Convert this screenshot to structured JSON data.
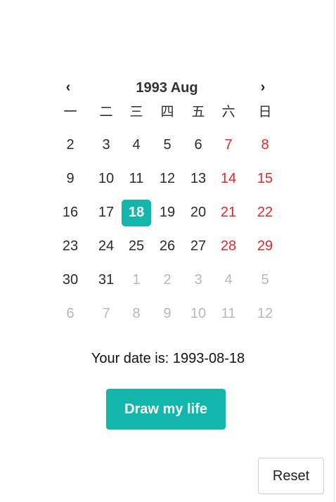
{
  "calendar": {
    "title": "1993 Aug",
    "prev_label": "‹",
    "next_label": "›",
    "weekdays": [
      "一",
      "二",
      "三",
      "四",
      "五",
      "六",
      "日"
    ],
    "weeks": [
      [
        {
          "d": "2"
        },
        {
          "d": "3"
        },
        {
          "d": "4"
        },
        {
          "d": "5"
        },
        {
          "d": "6"
        },
        {
          "d": "7",
          "weekend": true
        },
        {
          "d": "8",
          "weekend": true
        }
      ],
      [
        {
          "d": "9"
        },
        {
          "d": "10"
        },
        {
          "d": "11"
        },
        {
          "d": "12"
        },
        {
          "d": "13"
        },
        {
          "d": "14",
          "weekend": true
        },
        {
          "d": "15",
          "weekend": true
        }
      ],
      [
        {
          "d": "16"
        },
        {
          "d": "17"
        },
        {
          "d": "18",
          "selected": true
        },
        {
          "d": "19"
        },
        {
          "d": "20"
        },
        {
          "d": "21",
          "weekend": true
        },
        {
          "d": "22",
          "weekend": true
        }
      ],
      [
        {
          "d": "23"
        },
        {
          "d": "24"
        },
        {
          "d": "25"
        },
        {
          "d": "26"
        },
        {
          "d": "27"
        },
        {
          "d": "28",
          "weekend": true
        },
        {
          "d": "29",
          "weekend": true
        }
      ],
      [
        {
          "d": "30"
        },
        {
          "d": "31"
        },
        {
          "d": "1",
          "outside": true
        },
        {
          "d": "2",
          "outside": true
        },
        {
          "d": "3",
          "outside": true
        },
        {
          "d": "4",
          "outside": true
        },
        {
          "d": "5",
          "outside": true
        }
      ],
      [
        {
          "d": "6",
          "outside": true
        },
        {
          "d": "7",
          "outside": true
        },
        {
          "d": "8",
          "outside": true
        },
        {
          "d": "9",
          "outside": true
        },
        {
          "d": "10",
          "outside": true
        },
        {
          "d": "11",
          "outside": true
        },
        {
          "d": "12",
          "outside": true
        }
      ]
    ]
  },
  "result": {
    "text": "Your date is: 1993-08-18"
  },
  "actions": {
    "draw_label": "Draw my life",
    "reset_label": "Reset"
  },
  "colors": {
    "accent": "#14b6ac",
    "weekend": "#e0292a",
    "outside": "#b8b8b8"
  }
}
